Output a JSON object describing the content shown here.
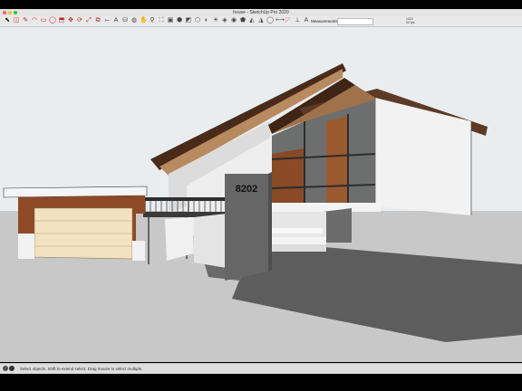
{
  "window": {
    "title": "house - SketchUp Pro 2020"
  },
  "toolbar": {
    "tools": [
      {
        "name": "select-tool-icon",
        "glyph": "⬉",
        "color": "#222"
      },
      {
        "name": "eraser-tool-icon",
        "glyph": "◫",
        "color": "#c33"
      },
      {
        "name": "line-tool-icon",
        "glyph": "✎",
        "color": "#b22"
      },
      {
        "name": "arc-tool-icon",
        "glyph": "◠",
        "color": "#b22"
      },
      {
        "name": "rectangle-tool-icon",
        "glyph": "▭",
        "color": "#b22"
      },
      {
        "name": "circle-tool-icon",
        "glyph": "◯",
        "color": "#b22"
      },
      {
        "name": "push-pull-tool-icon",
        "glyph": "⬒",
        "color": "#b22"
      },
      {
        "name": "move-tool-icon",
        "glyph": "✥",
        "color": "#b22"
      },
      {
        "name": "rotate-tool-icon",
        "glyph": "⟳",
        "color": "#b22"
      },
      {
        "name": "scale-tool-icon",
        "glyph": "⤢",
        "color": "#b22"
      },
      {
        "name": "offset-tool-icon",
        "glyph": "⧉",
        "color": "#b22"
      },
      {
        "name": "tape-measure-tool-icon",
        "glyph": "⤚",
        "color": "#444"
      },
      {
        "name": "text-tool-icon",
        "glyph": "A",
        "color": "#444"
      },
      {
        "name": "paint-bucket-tool-icon",
        "glyph": "⛁",
        "color": "#444"
      },
      {
        "name": "orbit-tool-icon",
        "glyph": "◍",
        "color": "#444"
      },
      {
        "name": "pan-tool-icon",
        "glyph": "✋",
        "color": "#444"
      },
      {
        "name": "zoom-tool-icon",
        "glyph": "⚲",
        "color": "#444"
      },
      {
        "name": "zoom-extents-tool-icon",
        "glyph": "⛶",
        "color": "#444"
      },
      {
        "name": "warehouse-icon",
        "glyph": "▣",
        "color": "#444"
      },
      {
        "name": "extension-warehouse-icon",
        "glyph": "⬢",
        "color": "#444"
      },
      {
        "name": "send-to-layout-icon",
        "glyph": "◩",
        "color": "#444"
      },
      {
        "name": "component-icon",
        "glyph": "⬡",
        "color": "#444"
      },
      {
        "name": "styles-icon",
        "glyph": "◐",
        "color": "#444"
      },
      {
        "name": "shadows-icon",
        "glyph": "☀",
        "color": "#444"
      },
      {
        "name": "section-plane-icon",
        "glyph": "◈",
        "color": "#444"
      },
      {
        "name": "solid-tools-icon",
        "glyph": "◉",
        "color": "#444"
      },
      {
        "name": "sandbox-icon",
        "glyph": "⬟",
        "color": "#444"
      },
      {
        "name": "follow-me-icon",
        "glyph": "◭",
        "color": "#444"
      },
      {
        "name": "intersect-icon",
        "glyph": "◮",
        "color": "#444"
      },
      {
        "name": "outer-shell-icon",
        "glyph": "◯",
        "color": "#444"
      },
      {
        "name": "dimension-icon",
        "glyph": "⟷",
        "color": "#444"
      },
      {
        "name": "protractor-icon",
        "glyph": "◸",
        "color": "#c88"
      },
      {
        "name": "axes-icon",
        "glyph": "⊥",
        "color": "#444"
      },
      {
        "name": "3d-text-icon",
        "glyph": "A",
        "color": "#444"
      }
    ],
    "measurements_label": "Measurements",
    "measurements_value": "",
    "stats_line1": "1024",
    "stats_line2": "60 fps"
  },
  "status": {
    "text": "Select objects. Shift to extend select. Drag mouse to select multiple."
  },
  "model": {
    "house_number": "8202"
  },
  "colors": {
    "sky": "#e9edf0",
    "ground": "#c8c8c8",
    "stucco": "#f2f2f2",
    "cedar": "#8a4a25",
    "garage_door": "#f3e2bf",
    "shadow": "#5d5d5d",
    "pillar": "#666666"
  }
}
